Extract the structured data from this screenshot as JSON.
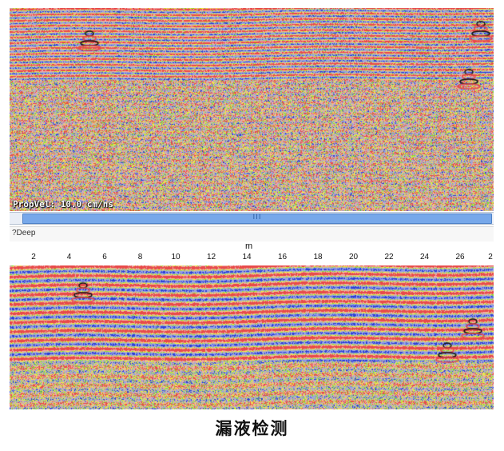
{
  "top_panel": {
    "propagation_velocity_label": "PropVel: 10.0 cm/ns",
    "scrollbar_grip": "III"
  },
  "section": {
    "label": "?Deep"
  },
  "axis": {
    "unit": "m",
    "ticks": [
      "2",
      "4",
      "6",
      "8",
      "10",
      "12",
      "14",
      "16",
      "18",
      "20",
      "22",
      "24",
      "26",
      "2"
    ]
  },
  "caption": "漏液检测",
  "colors": {
    "red": "#e84a4a",
    "blue": "#2c3fd6",
    "yellow": "#f2f23a",
    "green": "#7fe03a",
    "gray": "#b9b4ac",
    "scrollbar": "#77a8ea"
  }
}
